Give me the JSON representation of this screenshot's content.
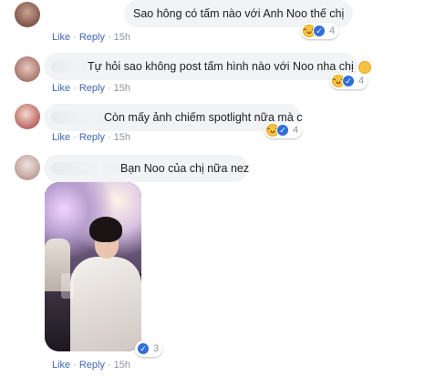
{
  "comments": [
    {
      "text": "Sao hông có tấm nào với Anh Noo thế chị",
      "actions": {
        "like": "Like",
        "reply": "Reply",
        "time": "15h"
      },
      "reaction_count": "4",
      "reaction_types": [
        "haha",
        "like"
      ]
    },
    {
      "text": "Tự hỏi sao không post tấm hình nào với Noo nha chị",
      "actions": {
        "like": "Like",
        "reply": "Reply",
        "time": "15h"
      },
      "reaction_count": "4",
      "reaction_types": [
        "haha",
        "like"
      ]
    },
    {
      "text": "Còn mấy ảnh chiếm spotlight nữa mà c",
      "actions": {
        "like": "Like",
        "reply": "Reply",
        "time": "15h"
      },
      "reaction_count": "4",
      "reaction_types": [
        "haha",
        "like"
      ]
    },
    {
      "text": "Bạn Noo của chị nữa nez",
      "actions": {
        "like": "Like",
        "reply": "Reply",
        "time": "15h"
      },
      "reaction_count": "3",
      "reaction_types": [
        "like"
      ]
    }
  ],
  "colors": {
    "link": "#4267b2",
    "muted": "#90949c",
    "bubble": "#f2f3f5",
    "like": "#2f6fd8",
    "haha": "#f7c340"
  },
  "icons": [
    "haha-reaction-icon",
    "like-reaction-icon",
    "laughing-emoji-icon"
  ]
}
